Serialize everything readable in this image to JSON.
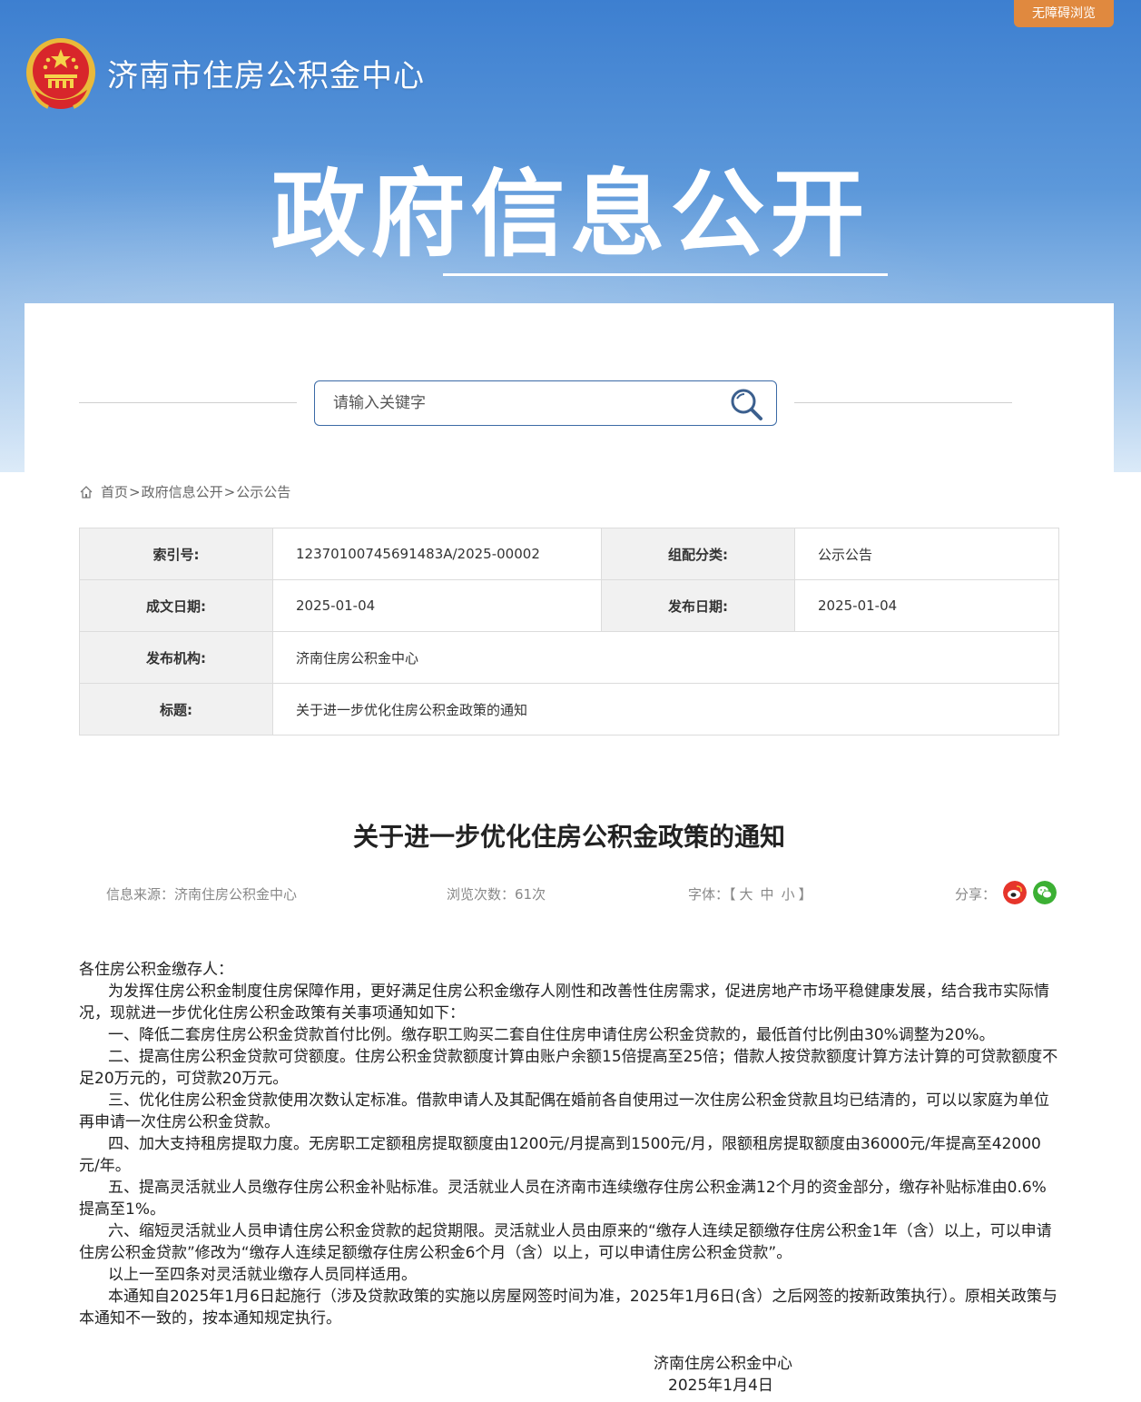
{
  "header": {
    "a11y_label": "无障碍浏览",
    "site_name": "济南市住房公积金中心",
    "hero_title": "政府信息公开"
  },
  "search": {
    "placeholder": "请输入关键字"
  },
  "breadcrumb": {
    "items": [
      "首页",
      "政府信息公开",
      "公示公告"
    ],
    "sep": ">"
  },
  "meta": {
    "index_label": "索引号:",
    "index_value": "12370100745691483A/2025-00002",
    "category_label": "组配分类:",
    "category_value": "公示公告",
    "written_label": "成文日期:",
    "written_value": "2025-01-04",
    "publish_label": "发布日期:",
    "publish_value": "2025-01-04",
    "org_label": "发布机构:",
    "org_value": "济南住房公积金中心",
    "title_label": "标题:",
    "title_value": "关于进一步优化住房公积金政策的通知"
  },
  "article": {
    "title": "关于进一步优化住房公积金政策的通知",
    "source": "信息来源：济南住房公积金中心",
    "views": "浏览次数：61次",
    "font_label": "字体：",
    "font_open": "【",
    "font_large": "大",
    "font_medium": "中",
    "font_small": "小",
    "font_close": "】",
    "share_label": "分享：",
    "greeting": "各住房公积金缴存人：",
    "paragraphs": [
      "为发挥住房公积金制度住房保障作用，更好满足住房公积金缴存人刚性和改善性住房需求，促进房地产市场平稳健康发展，结合我市实际情况，现就进一步优化住房公积金政策有关事项通知如下：",
      "一、降低二套房住房公积金贷款首付比例。缴存职工购买二套自住住房申请住房公积金贷款的，最低首付比例由30%调整为20%。",
      "二、提高住房公积金贷款可贷额度。住房公积金贷款额度计算由账户余额15倍提高至25倍；借款人按贷款额度计算方法计算的可贷款额度不足20万元的，可贷款20万元。",
      "三、优化住房公积金贷款使用次数认定标准。借款申请人及其配偶在婚前各自使用过一次住房公积金贷款且均已结清的，可以以家庭为单位再申请一次住房公积金贷款。",
      "四、加大支持租房提取力度。无房职工定额租房提取额度由1200元/月提高到1500元/月，限额租房提取额度由36000元/年提高至42000元/年。",
      "五、提高灵活就业人员缴存住房公积金补贴标准。灵活就业人员在济南市连续缴存住房公积金满12个月的资金部分，缴存补贴标准由0.6%提高至1%。",
      "六、缩短灵活就业人员申请住房公积金贷款的起贷期限。灵活就业人员由原来的“缴存人连续足额缴存住房公积金1年（含）以上，可以申请住房公积金贷款”修改为“缴存人连续足额缴存住房公积金6个月（含）以上，可以申请住房公积金贷款”。",
      "以上一至四条对灵活就业缴存人员同样适用。",
      "本通知自2025年1月6日起施行（涉及贷款政策的实施以房屋网签时间为准，2025年1月6日(含）之后网签的按新政策执行）。原相关政策与本通知不一致的，按本通知规定执行。"
    ],
    "sign_org": "济南住房公积金中心",
    "sign_date": "2025年1月4日"
  }
}
